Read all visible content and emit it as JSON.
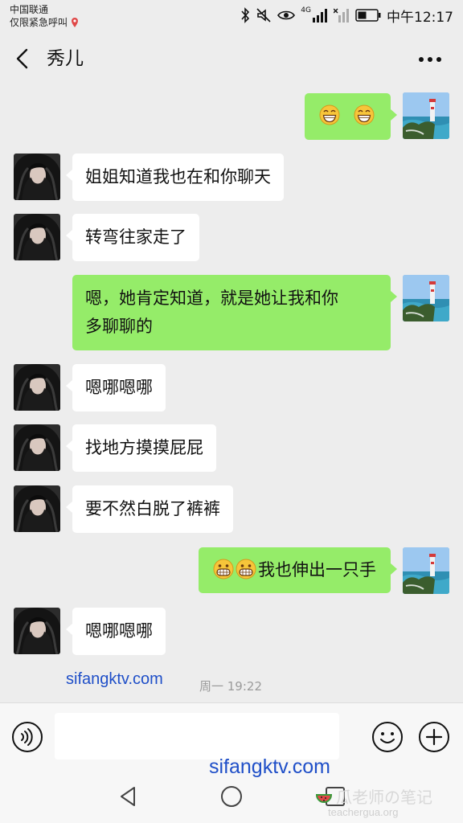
{
  "status_bar": {
    "carrier_line1": "中国联通",
    "carrier_line2": "仅限紧急呼叫",
    "network_label": "4G",
    "time": "中午12:17"
  },
  "header": {
    "back_icon": "chevron-left-icon",
    "title": "秀儿",
    "more_icon": "more-dots-icon"
  },
  "messages": [
    {
      "side": "right",
      "text": "",
      "emoji_count": 2,
      "emoji": "grin-emoji"
    },
    {
      "side": "left",
      "text": "姐姐知道我也在和你聊天"
    },
    {
      "side": "left",
      "text": "转弯往家走了"
    },
    {
      "side": "right",
      "text_line1": "嗯，她肯定知道，就是她让我和你",
      "text_line2": "多聊聊的"
    },
    {
      "side": "left",
      "text": "嗯哪嗯哪"
    },
    {
      "side": "left",
      "text": "找地方摸摸屁屁"
    },
    {
      "side": "left",
      "text": "要不然白脱了裤裤"
    },
    {
      "side": "right",
      "text": "我也伸出一只手",
      "emoji_count": 2,
      "emoji": "grimace-emoji"
    },
    {
      "side": "left",
      "text": "嗯哪嗯哪"
    }
  ],
  "timestamp": "周一 19:22",
  "watermarks": {
    "site1": "sifangktv.com",
    "site2": "sifangktv.com",
    "brand": "瓜老师の笔记",
    "brand_url": "teachergua.org"
  },
  "input_bar": {
    "voice_icon": "voice-icon",
    "input_value": "",
    "emoji_icon": "smile-icon",
    "plus_icon": "plus-icon"
  },
  "system_nav": {
    "back": "triangle-back-icon",
    "home": "circle-home-icon",
    "recent": "square-recent-icon"
  },
  "colors": {
    "background": "#ededed",
    "right_bubble": "#95ec69",
    "left_bubble": "#ffffff",
    "watermark_blue": "#1f4fc8"
  }
}
